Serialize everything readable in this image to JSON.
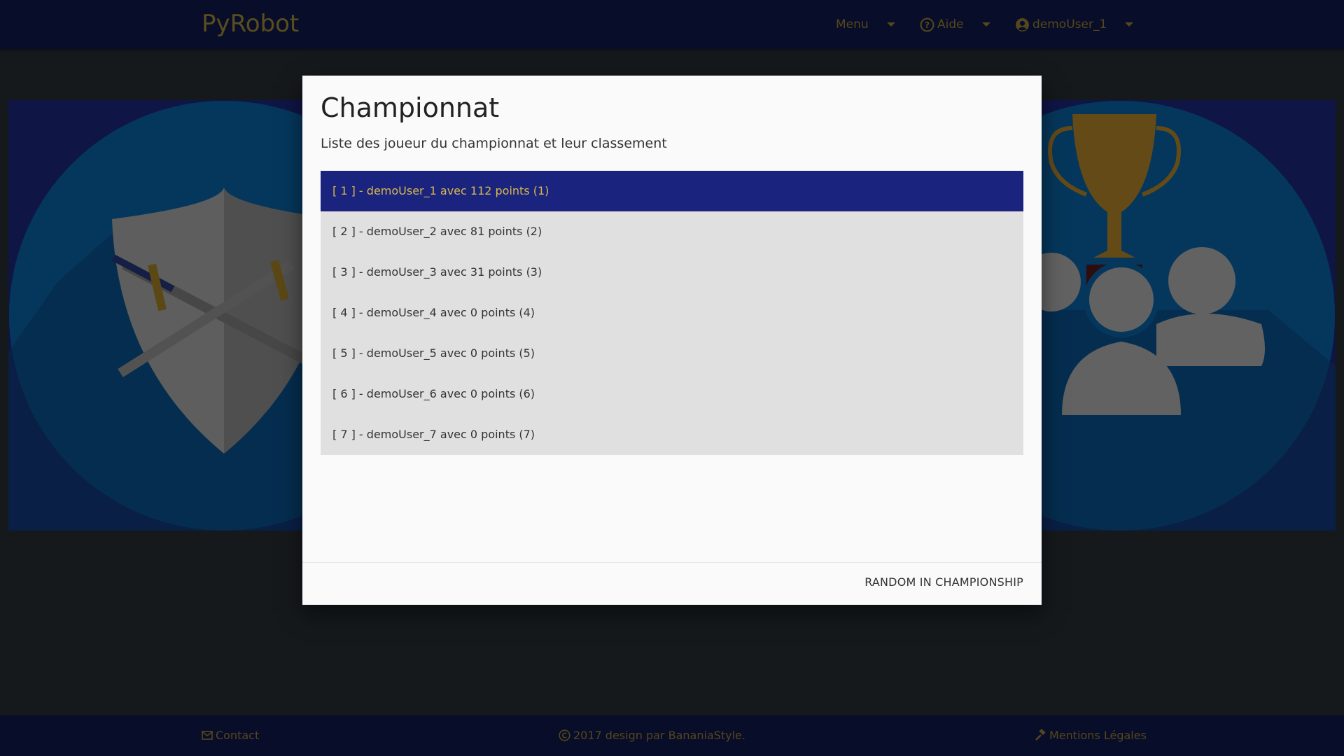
{
  "navbar": {
    "brand": "PyRobot",
    "menu_label": "Menu",
    "help_label": "Aide",
    "user_label": "demoUser_1"
  },
  "modal": {
    "title": "Championnat",
    "subtitle": "Liste des joueur du championnat et leur classement",
    "ranking": [
      {
        "label": "[ 1 ] - demoUser_1 avec 112 points (1)"
      },
      {
        "label": "[ 2 ] - demoUser_2 avec 81 points (2)"
      },
      {
        "label": "[ 3 ] - demoUser_3 avec 31 points (3)"
      },
      {
        "label": "[ 4 ] - demoUser_4 avec 0 points (4)"
      },
      {
        "label": "[ 5 ] - demoUser_5 avec 0 points (5)"
      },
      {
        "label": "[ 6 ] - demoUser_6 avec 0 points (6)"
      },
      {
        "label": "[ 7 ] - demoUser_7 avec 0 points (7)"
      }
    ],
    "footer_button": "RANDOM IN CHAMPIONSHIP"
  },
  "footer": {
    "contact": "Contact",
    "copyright": "2017 design par BananiaStyle.",
    "legal": "Mentions Légales"
  },
  "colors": {
    "navbar_bg": "#101a52",
    "accent_gold": "#a88f36",
    "active_row_bg": "#1a237e",
    "hero_bg": "#1e2a8a",
    "circle_blue": "#0a6fb8"
  },
  "icons": {
    "help": "question-circle-icon",
    "user": "user-circle-icon",
    "contact": "envelope-icon",
    "copyright": "copyright-icon",
    "legal": "gavel-icon"
  }
}
